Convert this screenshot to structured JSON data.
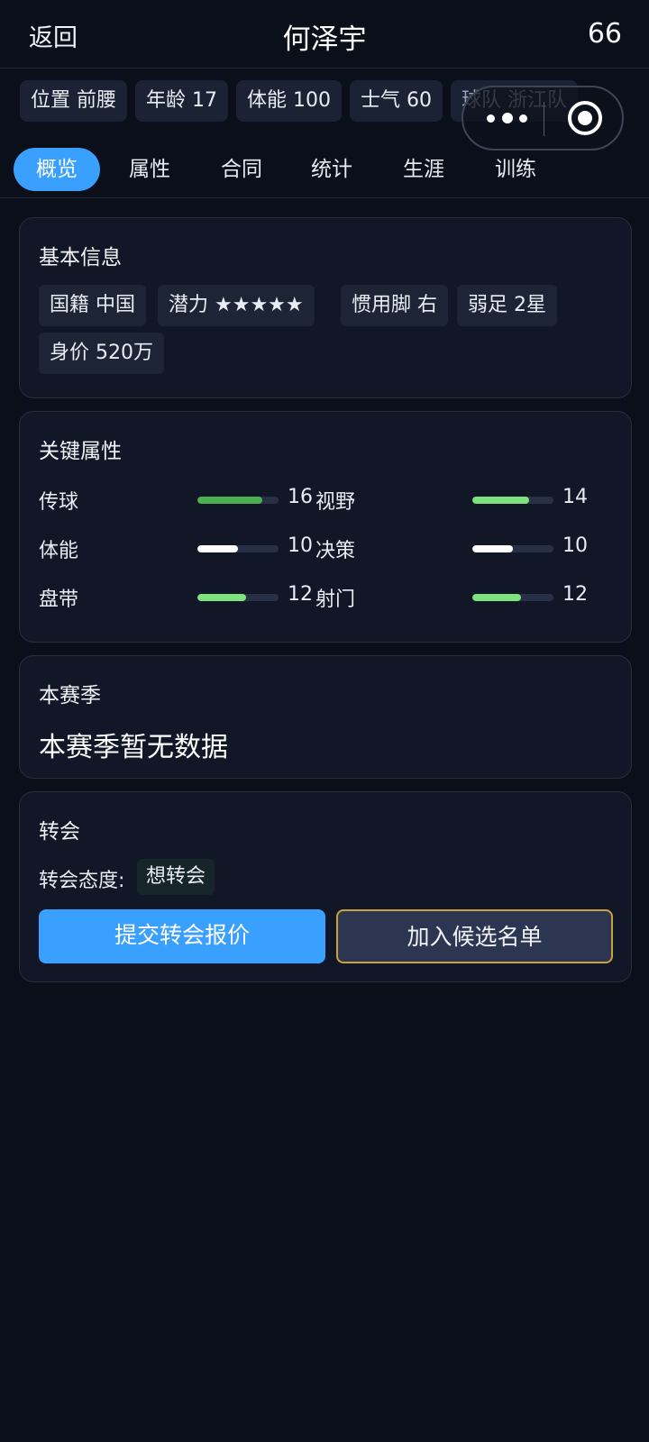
{
  "header": {
    "back_label": "返回",
    "title": "何泽宇",
    "rating": "66"
  },
  "chips": [
    {
      "text": "位置 前腰"
    },
    {
      "text": "年龄 17"
    },
    {
      "text": "体能 100"
    },
    {
      "text": "士气 60"
    },
    {
      "text": "球队 浙江队"
    }
  ],
  "tabs": [
    {
      "label": "概览",
      "active": true
    },
    {
      "label": "属性"
    },
    {
      "label": "合同"
    },
    {
      "label": "统计"
    },
    {
      "label": "生涯"
    },
    {
      "label": "训练"
    }
  ],
  "basic_info": {
    "title": "基本信息",
    "tags": [
      "国籍 中国",
      "潜力 ★★★★★",
      "惯用脚 右",
      "弱足 2星",
      "身价 520万"
    ]
  },
  "key_attributes": {
    "title": "关键属性",
    "rows": [
      {
        "left": {
          "name": "传球",
          "value": "16",
          "level": 0.8,
          "color": "#4caf50"
        },
        "right": {
          "name": "视野",
          "value": "14",
          "level": 0.7,
          "color": "#7ee27e"
        }
      },
      {
        "left": {
          "name": "体能",
          "value": "10",
          "level": 0.5,
          "color": "#ffffff"
        },
        "right": {
          "name": "决策",
          "value": "10",
          "level": 0.5,
          "color": "#ffffff"
        }
      },
      {
        "left": {
          "name": "盘带",
          "value": "12",
          "level": 0.6,
          "color": "#7ee27e"
        },
        "right": {
          "name": "射门",
          "value": "12",
          "level": 0.6,
          "color": "#7ee27e"
        }
      }
    ]
  },
  "season": {
    "title": "本赛季",
    "empty_text": "本赛季暂无数据"
  },
  "transfer": {
    "title": "转会",
    "attitude_label": "转会态度:",
    "attitude_value": "想转会",
    "submit_label": "提交转会报价",
    "shortlist_label": "加入候选名单"
  },
  "colors": {
    "accent": "#3aa0ff",
    "background": "#0b0f1a",
    "card": "#111727",
    "shortlist_border": "#c9a33a"
  },
  "icons": {
    "menu": "more-dots-icon",
    "close": "target-circle-icon"
  }
}
